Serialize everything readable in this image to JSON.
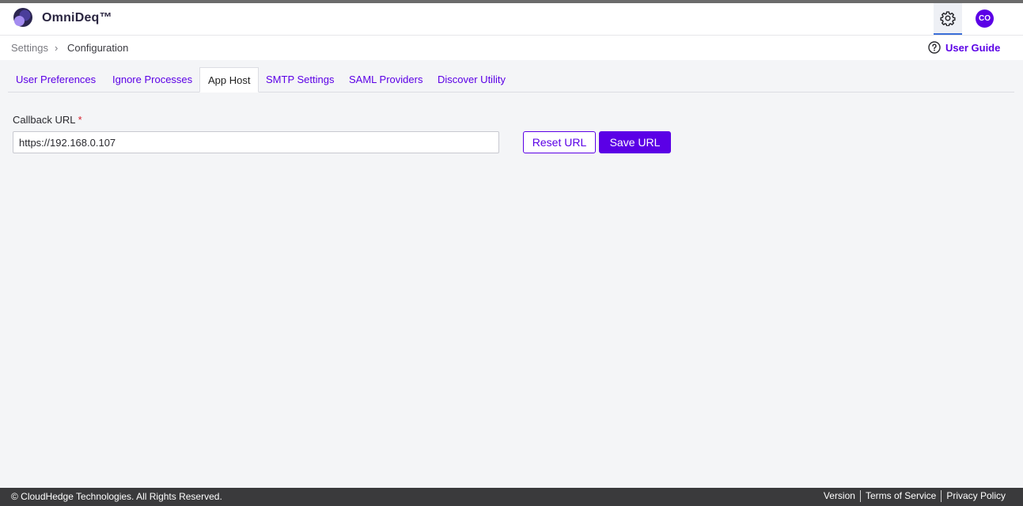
{
  "app": {
    "name": "OmniDeq™",
    "avatar_initials": "CO"
  },
  "breadcrumb": {
    "root": "Settings",
    "separator": "›",
    "current": "Configuration"
  },
  "help": {
    "label": "User Guide"
  },
  "tabs": [
    {
      "label": "User Preferences",
      "active": false
    },
    {
      "label": "Ignore Processes",
      "active": false
    },
    {
      "label": "App Host",
      "active": true
    },
    {
      "label": "SMTP Settings",
      "active": false
    },
    {
      "label": "SAML Providers",
      "active": false
    },
    {
      "label": "Discover Utility",
      "active": false
    }
  ],
  "form": {
    "callback_label": "Callback URL",
    "required_mark": "*",
    "callback_value": "https://192.168.0.107",
    "reset_label": "Reset URL",
    "save_label": "Save URL"
  },
  "footer": {
    "copyright": "© CloudHedge Technologies. All Rights Reserved.",
    "links": [
      "Version",
      "Terms of Service",
      "Privacy Policy"
    ]
  },
  "colors": {
    "accent": "#5b00e6",
    "footer_bg": "#3a3a3c",
    "page_bg": "#f4f5f7"
  },
  "icons": [
    "app-logo-icon",
    "gear-icon",
    "help-circle-icon",
    "chevron-right-icon"
  ]
}
